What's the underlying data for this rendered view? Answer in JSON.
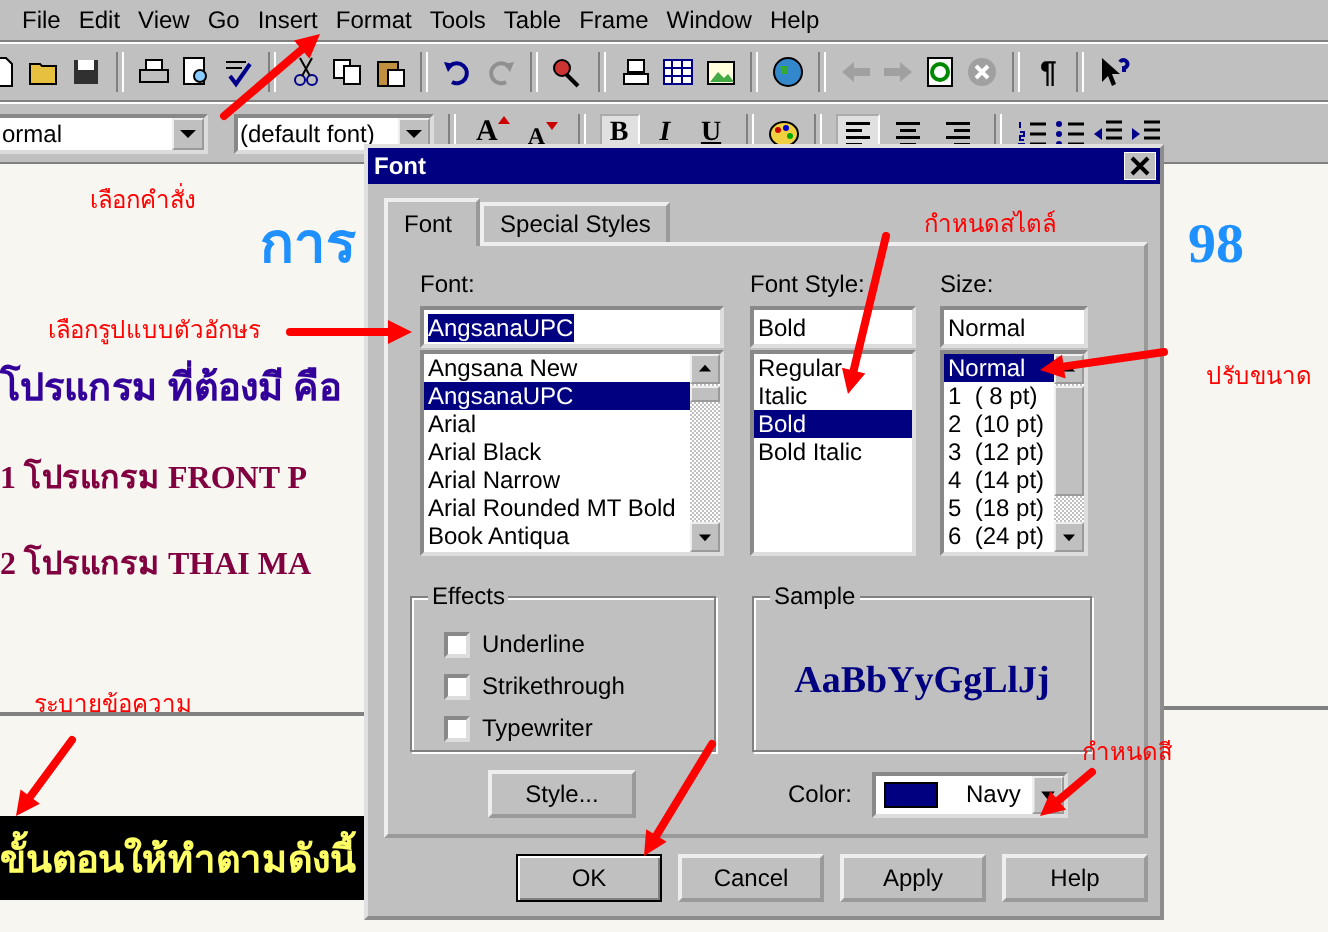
{
  "menu_bar": {
    "items": [
      "File",
      "Edit",
      "View",
      "Go",
      "Insert",
      "Format",
      "Tools",
      "Table",
      "Frame",
      "Window",
      "Help"
    ]
  },
  "toolbar": {
    "pilcrow": "¶"
  },
  "format_bar": {
    "style_select": "ormal",
    "font_select": "(default font)",
    "size_buttons": [
      {
        "label": "A",
        "kind": "grow"
      },
      {
        "label": "A",
        "kind": "shrink"
      }
    ],
    "text_buttons": [
      {
        "label": "B",
        "kind": "bold",
        "selected": true
      },
      {
        "label": "I",
        "kind": "italic",
        "selected": false
      },
      {
        "label": "U",
        "kind": "underline",
        "selected": false
      }
    ],
    "align_buttons": [
      {
        "kind": "left",
        "selected": true
      },
      {
        "kind": "center",
        "selected": false
      },
      {
        "kind": "right",
        "selected": false
      }
    ]
  },
  "document": {
    "heading": "การ",
    "heading_end": "98",
    "lines": [
      {
        "text": "โปรแกรม ที่ต้องมี คือ",
        "kind": "intro"
      },
      {
        "text": "1 โปรแกรม FRONT P",
        "kind": "item"
      },
      {
        "text": "2 โปรแกรม THAI MA",
        "kind": "item"
      }
    ],
    "banner": "ขั้นตอนให้ทำตามดังนี้"
  },
  "annotations": [
    "เลือกคำสั่ง",
    "กำหนดสไตล์",
    "เลือกรูปแบบตัวอักษร",
    "ปรับขนาด",
    "ระบายข้อความ",
    "กำหนดสี"
  ],
  "font_dialog": {
    "title": "Font",
    "tabs": [
      {
        "label": "Font",
        "selected": true
      },
      {
        "label": "Special Styles",
        "selected": false
      }
    ],
    "font": {
      "label": "Font:",
      "value": "AngsanaUPC",
      "options": [
        {
          "label": "Angsana New",
          "selected": false
        },
        {
          "label": "AngsanaUPC",
          "selected": true
        },
        {
          "label": "Arial",
          "selected": false
        },
        {
          "label": "Arial Black",
          "selected": false
        },
        {
          "label": "Arial Narrow",
          "selected": false
        },
        {
          "label": "Arial Rounded MT Bold",
          "selected": false
        },
        {
          "label": "Book Antiqua",
          "selected": false
        }
      ]
    },
    "style": {
      "label": "Font Style:",
      "value": "Bold",
      "options": [
        {
          "label": "Regular",
          "selected": false
        },
        {
          "label": "Italic",
          "selected": false
        },
        {
          "label": "Bold",
          "selected": true
        },
        {
          "label": "Bold Italic",
          "selected": false
        }
      ]
    },
    "size": {
      "label": "Size:",
      "value": "Normal",
      "options": [
        {
          "label": "Normal",
          "selected": true
        },
        {
          "label": "1  ( 8 pt)",
          "selected": false
        },
        {
          "label": "2  (10 pt)",
          "selected": false
        },
        {
          "label": "3  (12 pt)",
          "selected": false
        },
        {
          "label": "4  (14 pt)",
          "selected": false
        },
        {
          "label": "5  (18 pt)",
          "selected": false
        },
        {
          "label": "6  (24 pt)",
          "selected": false
        }
      ]
    },
    "effects": {
      "title": "Effects",
      "options": [
        {
          "label": "Underline",
          "checked": false
        },
        {
          "label": "Strikethrough",
          "checked": false
        },
        {
          "label": "Typewriter",
          "checked": false
        }
      ]
    },
    "sample": {
      "title": "Sample",
      "text": "AaBbYyGgLlJj"
    },
    "style_button": "Style...",
    "color": {
      "label": "Color:",
      "value": "Navy"
    },
    "buttons": [
      {
        "label": "OK",
        "kind": "default"
      },
      {
        "label": "Cancel",
        "kind": "normal"
      },
      {
        "label": "Apply",
        "kind": "normal"
      },
      {
        "label": "Help",
        "kind": "normal"
      }
    ]
  }
}
